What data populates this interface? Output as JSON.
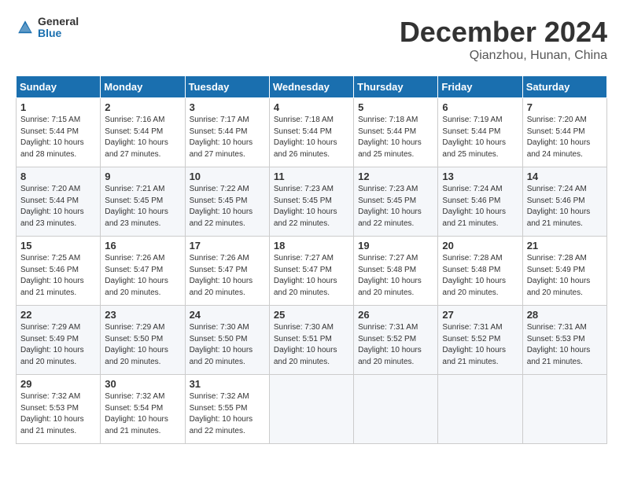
{
  "header": {
    "logo_general": "General",
    "logo_blue": "Blue",
    "month": "December 2024",
    "location": "Qianzhou, Hunan, China"
  },
  "weekdays": [
    "Sunday",
    "Monday",
    "Tuesday",
    "Wednesday",
    "Thursday",
    "Friday",
    "Saturday"
  ],
  "weeks": [
    [
      {
        "day": "1",
        "sunrise": "7:15 AM",
        "sunset": "5:44 PM",
        "daylight": "10 hours and 28 minutes."
      },
      {
        "day": "2",
        "sunrise": "7:16 AM",
        "sunset": "5:44 PM",
        "daylight": "10 hours and 27 minutes."
      },
      {
        "day": "3",
        "sunrise": "7:17 AM",
        "sunset": "5:44 PM",
        "daylight": "10 hours and 27 minutes."
      },
      {
        "day": "4",
        "sunrise": "7:18 AM",
        "sunset": "5:44 PM",
        "daylight": "10 hours and 26 minutes."
      },
      {
        "day": "5",
        "sunrise": "7:18 AM",
        "sunset": "5:44 PM",
        "daylight": "10 hours and 25 minutes."
      },
      {
        "day": "6",
        "sunrise": "7:19 AM",
        "sunset": "5:44 PM",
        "daylight": "10 hours and 25 minutes."
      },
      {
        "day": "7",
        "sunrise": "7:20 AM",
        "sunset": "5:44 PM",
        "daylight": "10 hours and 24 minutes."
      }
    ],
    [
      {
        "day": "8",
        "sunrise": "7:20 AM",
        "sunset": "5:44 PM",
        "daylight": "10 hours and 23 minutes."
      },
      {
        "day": "9",
        "sunrise": "7:21 AM",
        "sunset": "5:45 PM",
        "daylight": "10 hours and 23 minutes."
      },
      {
        "day": "10",
        "sunrise": "7:22 AM",
        "sunset": "5:45 PM",
        "daylight": "10 hours and 22 minutes."
      },
      {
        "day": "11",
        "sunrise": "7:23 AM",
        "sunset": "5:45 PM",
        "daylight": "10 hours and 22 minutes."
      },
      {
        "day": "12",
        "sunrise": "7:23 AM",
        "sunset": "5:45 PM",
        "daylight": "10 hours and 22 minutes."
      },
      {
        "day": "13",
        "sunrise": "7:24 AM",
        "sunset": "5:46 PM",
        "daylight": "10 hours and 21 minutes."
      },
      {
        "day": "14",
        "sunrise": "7:24 AM",
        "sunset": "5:46 PM",
        "daylight": "10 hours and 21 minutes."
      }
    ],
    [
      {
        "day": "15",
        "sunrise": "7:25 AM",
        "sunset": "5:46 PM",
        "daylight": "10 hours and 21 minutes."
      },
      {
        "day": "16",
        "sunrise": "7:26 AM",
        "sunset": "5:47 PM",
        "daylight": "10 hours and 20 minutes."
      },
      {
        "day": "17",
        "sunrise": "7:26 AM",
        "sunset": "5:47 PM",
        "daylight": "10 hours and 20 minutes."
      },
      {
        "day": "18",
        "sunrise": "7:27 AM",
        "sunset": "5:47 PM",
        "daylight": "10 hours and 20 minutes."
      },
      {
        "day": "19",
        "sunrise": "7:27 AM",
        "sunset": "5:48 PM",
        "daylight": "10 hours and 20 minutes."
      },
      {
        "day": "20",
        "sunrise": "7:28 AM",
        "sunset": "5:48 PM",
        "daylight": "10 hours and 20 minutes."
      },
      {
        "day": "21",
        "sunrise": "7:28 AM",
        "sunset": "5:49 PM",
        "daylight": "10 hours and 20 minutes."
      }
    ],
    [
      {
        "day": "22",
        "sunrise": "7:29 AM",
        "sunset": "5:49 PM",
        "daylight": "10 hours and 20 minutes."
      },
      {
        "day": "23",
        "sunrise": "7:29 AM",
        "sunset": "5:50 PM",
        "daylight": "10 hours and 20 minutes."
      },
      {
        "day": "24",
        "sunrise": "7:30 AM",
        "sunset": "5:50 PM",
        "daylight": "10 hours and 20 minutes."
      },
      {
        "day": "25",
        "sunrise": "7:30 AM",
        "sunset": "5:51 PM",
        "daylight": "10 hours and 20 minutes."
      },
      {
        "day": "26",
        "sunrise": "7:31 AM",
        "sunset": "5:52 PM",
        "daylight": "10 hours and 20 minutes."
      },
      {
        "day": "27",
        "sunrise": "7:31 AM",
        "sunset": "5:52 PM",
        "daylight": "10 hours and 21 minutes."
      },
      {
        "day": "28",
        "sunrise": "7:31 AM",
        "sunset": "5:53 PM",
        "daylight": "10 hours and 21 minutes."
      }
    ],
    [
      {
        "day": "29",
        "sunrise": "7:32 AM",
        "sunset": "5:53 PM",
        "daylight": "10 hours and 21 minutes."
      },
      {
        "day": "30",
        "sunrise": "7:32 AM",
        "sunset": "5:54 PM",
        "daylight": "10 hours and 21 minutes."
      },
      {
        "day": "31",
        "sunrise": "7:32 AM",
        "sunset": "5:55 PM",
        "daylight": "10 hours and 22 minutes."
      },
      null,
      null,
      null,
      null
    ]
  ]
}
